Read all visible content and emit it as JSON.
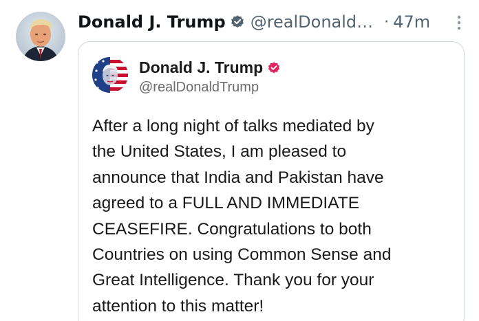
{
  "post": {
    "author_name": "Donald J. Trump",
    "handle": "@realDonald…",
    "separator": "·",
    "time": "47m",
    "avatar_icon": "profile-photo",
    "verified_icon": "verified-badge-icon",
    "verified_color": "#536471",
    "more_icon": "more-vertical-icon"
  },
  "quote": {
    "author_name": "Donald J. Trump",
    "handle": "@realDonaldTrump",
    "verified_icon": "verified-badge-icon",
    "verified_color": "#e0245e",
    "avatar_icon": "flag-portrait-avatar",
    "text_lines": [
      "After a long night of talks mediated by",
      "the United States, I am pleased to",
      "announce that India and Pakistan have",
      "agreed to a FULL AND IMMEDIATE",
      "CEASEFIRE. Congratulations to both",
      "Countries on using Common Sense and",
      "Great Intelligence. Thank you for your",
      "attention to this matter!"
    ]
  }
}
